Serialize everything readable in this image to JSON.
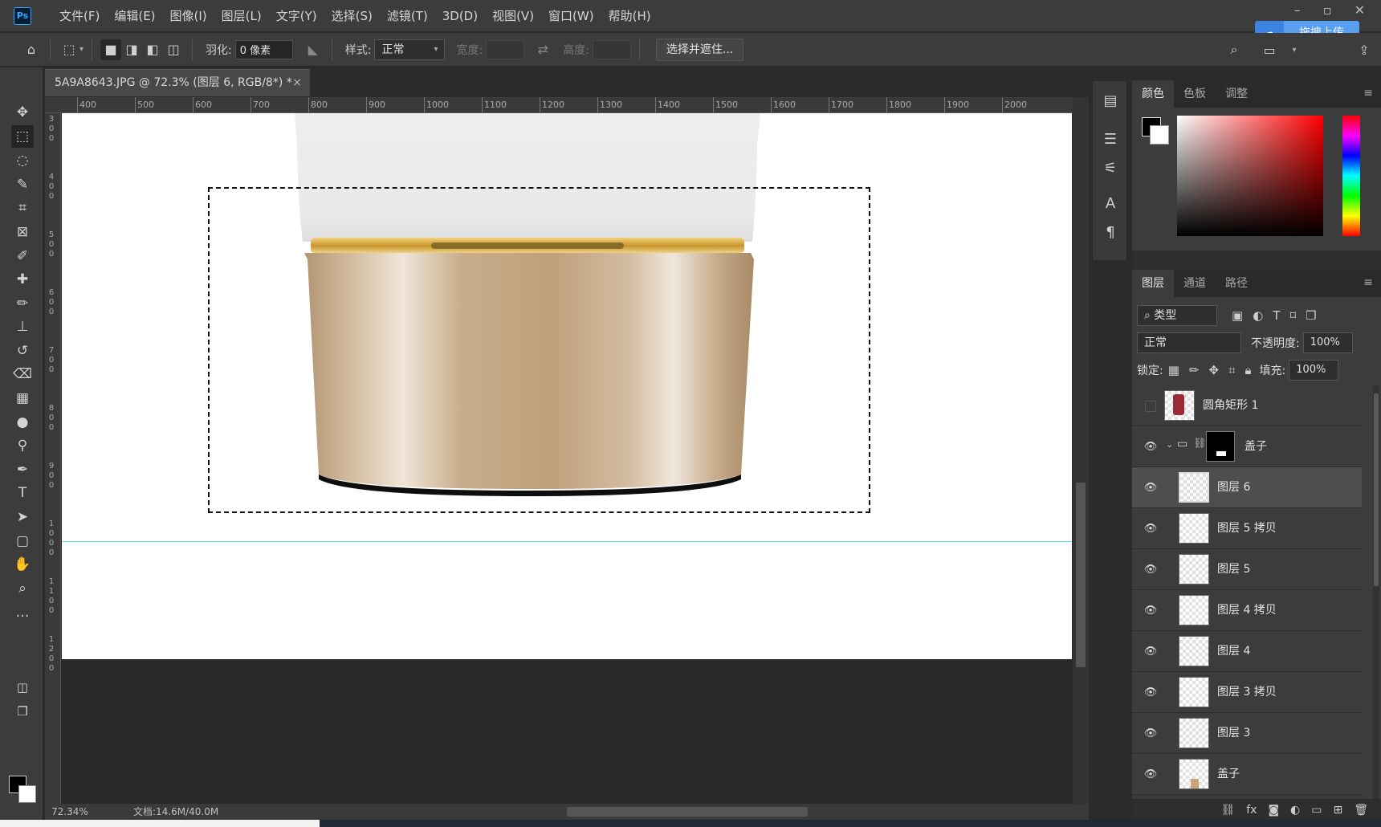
{
  "app": {
    "menu": [
      "文件(F)",
      "编辑(E)",
      "图像(I)",
      "图层(L)",
      "文字(Y)",
      "选择(S)",
      "滤镜(T)",
      "3D(D)",
      "视图(V)",
      "窗口(W)",
      "帮助(H)"
    ],
    "upload_label": "拖拽上传"
  },
  "options": {
    "feather_label": "羽化:",
    "feather_value": "0 像素",
    "style_label": "样式:",
    "style_value": "正常",
    "width_label": "宽度:",
    "height_label": "高度:",
    "select_mask_label": "选择并遮住..."
  },
  "document": {
    "tab_title": "5A9A8643.JPG @ 72.3% (图层 6, RGB/8*) *",
    "ruler_ticks": [
      "400",
      "500",
      "600",
      "700",
      "800",
      "900",
      "1000",
      "1100",
      "1200",
      "1300",
      "1400",
      "1500",
      "1600",
      "1700",
      "1800",
      "1900",
      "2000"
    ],
    "vruler_ticks": [
      "300",
      "400",
      "500",
      "600",
      "700",
      "800",
      "900",
      "1000",
      "1100",
      "1200"
    ],
    "zoom": "72.34%",
    "doc_size": "文档:14.6M/40.0M"
  },
  "color_panel": {
    "tabs": [
      "颜色",
      "色板",
      "调整"
    ],
    "fg_color": "#000000",
    "bg_color": "#ffffff"
  },
  "layers_panel": {
    "tabs": [
      "图层",
      "通道",
      "路径"
    ],
    "filter_kind": "类型",
    "blend_mode": "正常",
    "opacity_label": "不透明度:",
    "opacity_value": "100%",
    "lock_label": "锁定:",
    "fill_label": "填充:",
    "fill_value": "100%",
    "layers": [
      {
        "name": "圆角矩形 1",
        "visible": false
      },
      {
        "name": "盖子",
        "visible": true,
        "group": true
      },
      {
        "name": "图层 6",
        "visible": true,
        "selected": true
      },
      {
        "name": "图层 5 拷贝",
        "visible": true
      },
      {
        "name": "图层 5",
        "visible": true
      },
      {
        "name": "图层 4 拷贝",
        "visible": true
      },
      {
        "name": "图层 4",
        "visible": true
      },
      {
        "name": "图层 3 拷贝",
        "visible": true
      },
      {
        "name": "图层 3",
        "visible": true
      },
      {
        "name": "盖子",
        "visible": true
      }
    ]
  }
}
